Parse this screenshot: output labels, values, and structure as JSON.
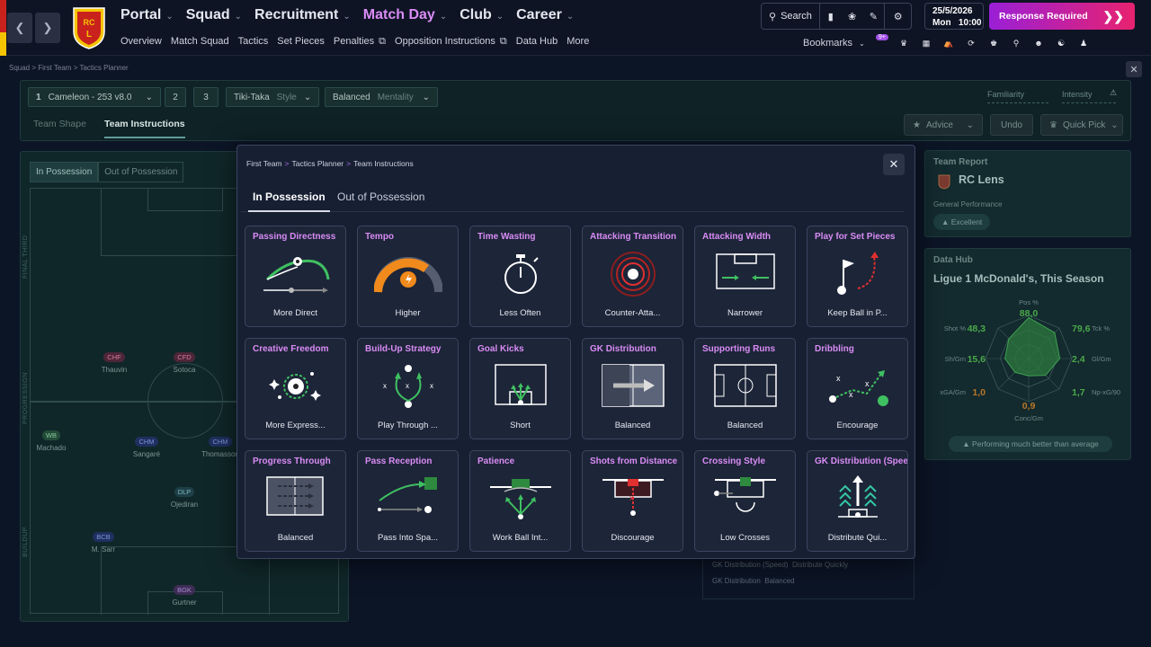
{
  "nav": {
    "menu": [
      {
        "label": "Portal",
        "active": false
      },
      {
        "label": "Squad",
        "active": false
      },
      {
        "label": "Recruitment",
        "active": false
      },
      {
        "label": "Match Day",
        "active": true
      },
      {
        "label": "Club",
        "active": false
      },
      {
        "label": "Career",
        "active": false
      }
    ],
    "submenu": [
      "Overview",
      "Match Squad",
      "Tactics",
      "Set Pieces",
      "Penalties",
      "Opposition Instructions",
      "Data Hub",
      "More"
    ],
    "search_label": "Search",
    "date": "25/5/2026",
    "day": "Mon",
    "time": "10:00",
    "response_label": "Response Required",
    "bookmarks_label": "Bookmarks",
    "bookmark_badge": "9+",
    "colors": {
      "accent": "#d98cf5",
      "response_from": "#9a1fd6",
      "response_to": "#e8226f"
    }
  },
  "page": {
    "breadcrumb": [
      "Squad",
      "First Team",
      "Tactics Planner"
    ],
    "tactic_select": {
      "num": "1",
      "label": "Cameleon - 253 v8.0"
    },
    "slot_2": "2",
    "slot_3": "3",
    "style": {
      "value": "Tiki-Taka",
      "label": "Style"
    },
    "mentality": {
      "value": "Balanced",
      "label": "Mentality"
    },
    "familiarity_label": "Familiarity",
    "intensity_label": "Intensity",
    "tabs": [
      "Team Shape",
      "Team Instructions"
    ],
    "advice_label": "Advice",
    "undo_label": "Undo",
    "quickpick_label": "Quick Pick",
    "pitch_toggle": [
      "In Possession",
      "Out of Possession"
    ],
    "zones": [
      "FINAL THIRD",
      "PROGRESSION",
      "BUILDUP"
    ],
    "players": [
      {
        "pos": "CHF",
        "name": "Thauvin",
        "cls": "att"
      },
      {
        "pos": "CFD",
        "name": "Sotoca",
        "cls": "att"
      },
      {
        "pos": "WB",
        "name": "Machado",
        "cls": "wb"
      },
      {
        "pos": "CHM",
        "name": "Sangaré",
        "cls": "mid"
      },
      {
        "pos": "CHM",
        "name": "Thomasson",
        "cls": "mid"
      },
      {
        "pos": "DLP",
        "name": "Ojediran",
        "cls": "def"
      },
      {
        "pos": "BCB",
        "name": "M. Sarr",
        "cls": "mid"
      },
      {
        "pos": "BGK",
        "name": "Gurtner",
        "cls": "gk"
      }
    ],
    "team_report": {
      "title": "Team Report",
      "club": "RC Lens",
      "perf_label": "General Performance",
      "perf_value": "Excellent"
    },
    "data_hub": {
      "title": "Data Hub",
      "subtitle": "Ligue 1 McDonald's, This Season",
      "stats": [
        {
          "label": "Pos %",
          "value": "88,0"
        },
        {
          "label": "Tck %",
          "value": "79,6"
        },
        {
          "label": "Gl/Gm",
          "value": "2,4"
        },
        {
          "label": "Np-xG/90",
          "value": "1,7"
        },
        {
          "label": "Conc/Gm",
          "value": "0,9"
        },
        {
          "label": "xGA/Gm",
          "value": "1,0"
        },
        {
          "label": "Sh/Gm",
          "value": "15,6"
        },
        {
          "label": "Shot %",
          "value": "48,3"
        }
      ],
      "footer": "Performing much better than average"
    },
    "lower_rows": [
      {
        "label": "GK Distribution (Speed)",
        "value": "Distribute Quickly"
      },
      {
        "label": "GK Distribution",
        "value": "Balanced"
      }
    ]
  },
  "modal": {
    "breadcrumb": [
      "First Team",
      "Tactics Planner",
      "Team Instructions"
    ],
    "tabs": [
      "In Possession",
      "Out of Possession"
    ],
    "cards": [
      {
        "title": "Passing Directness",
        "value": "More Direct",
        "icon": "passing-directness-icon"
      },
      {
        "title": "Tempo",
        "value": "Higher",
        "icon": "tempo-gauge-icon"
      },
      {
        "title": "Time Wasting",
        "value": "Less Often",
        "icon": "stopwatch-icon"
      },
      {
        "title": "Attacking Transition",
        "value": "Counter-Atta...",
        "icon": "counter-attack-icon"
      },
      {
        "title": "Attacking Width",
        "value": "Narrower",
        "icon": "narrow-width-icon"
      },
      {
        "title": "Play for Set Pieces",
        "value": "Keep Ball in P...",
        "icon": "corner-flag-icon"
      },
      {
        "title": "Creative Freedom",
        "value": "More Express...",
        "icon": "creative-ball-icon"
      },
      {
        "title": "Build-Up Strategy",
        "value": "Play Through ...",
        "icon": "build-up-icon"
      },
      {
        "title": "Goal Kicks",
        "value": "Short",
        "icon": "goal-kick-icon"
      },
      {
        "title": "GK Distribution",
        "value": "Balanced",
        "icon": "gk-distribution-icon"
      },
      {
        "title": "Supporting Runs",
        "value": "Balanced",
        "icon": "supporting-runs-icon"
      },
      {
        "title": "Dribbling",
        "value": "Encourage",
        "icon": "dribbling-icon"
      },
      {
        "title": "Progress Through",
        "value": "Balanced",
        "icon": "progress-through-icon"
      },
      {
        "title": "Pass Reception",
        "value": "Pass Into Spa...",
        "icon": "pass-reception-icon"
      },
      {
        "title": "Patience",
        "value": "Work Ball Int...",
        "icon": "patience-icon"
      },
      {
        "title": "Shots from Distance",
        "value": "Discourage",
        "icon": "shots-distance-icon"
      },
      {
        "title": "Crossing Style",
        "value": "Low Crosses",
        "icon": "crossing-style-icon"
      },
      {
        "title": "GK Distribution (Speed",
        "value": "Distribute Qui...",
        "icon": "gk-speed-icon"
      }
    ]
  }
}
